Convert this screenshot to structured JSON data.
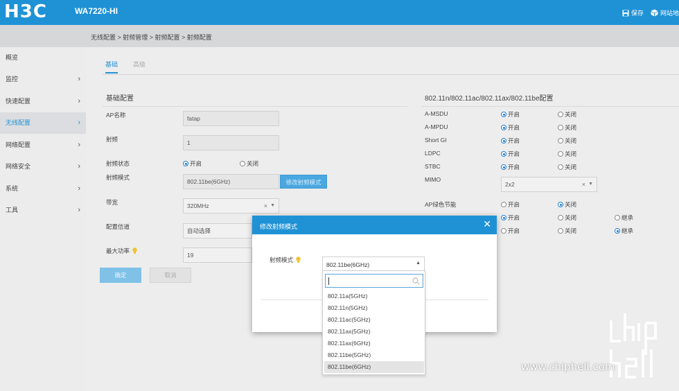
{
  "header": {
    "logo": "H3C",
    "model": "WA7220-HI",
    "actions": [
      {
        "label": "保存",
        "icon": "save-icon"
      },
      {
        "label": "网站地",
        "icon": "cube-icon"
      }
    ]
  },
  "breadcrumb": "无线配置 > 射频管理 > 射频配置 > 射频配置",
  "sidebar": {
    "items": [
      {
        "label": "概览",
        "chevron": false,
        "active": false
      },
      {
        "label": "监控",
        "chevron": true,
        "active": false
      },
      {
        "label": "快速配置",
        "chevron": true,
        "active": false
      },
      {
        "label": "无线配置",
        "chevron": true,
        "active": true
      },
      {
        "label": "网络配置",
        "chevron": true,
        "active": false
      },
      {
        "label": "网络安全",
        "chevron": true,
        "active": false
      },
      {
        "label": "系统",
        "chevron": true,
        "active": false
      },
      {
        "label": "工具",
        "chevron": true,
        "active": false
      }
    ]
  },
  "tabs": [
    {
      "label": "基础",
      "active": true
    },
    {
      "label": "高级",
      "active": false
    }
  ],
  "basic": {
    "title": "基础配置",
    "ap_name": {
      "label": "AP名称",
      "value": "fatap"
    },
    "radio": {
      "label": "射频",
      "value": "1"
    },
    "radio_state": {
      "label": "射频状态",
      "on": "开启",
      "off": "关闭",
      "value": "on"
    },
    "radio_mode": {
      "label": "射频模式",
      "value": "802.11be(6GHz)",
      "button": "修改射频模式"
    },
    "bandwidth": {
      "label": "带宽",
      "value": "320MHz",
      "clear": "×",
      "arrow": "▼"
    },
    "channel": {
      "label": "配置信道",
      "value": "自动选择"
    },
    "max_power": {
      "label": "最大功率",
      "value": "19"
    },
    "confirm": "确定",
    "cancel": "取消"
  },
  "advanced": {
    "title": "802.11n/802.11ac/802.11ax/802.11be配置",
    "rows": [
      {
        "label": "A-MSDU",
        "on": "开启",
        "off": "关闭",
        "value": "on"
      },
      {
        "label": "A-MPDU",
        "on": "开启",
        "off": "关闭",
        "value": "on"
      },
      {
        "label": "Short GI",
        "on": "开启",
        "off": "关闭",
        "value": "on"
      },
      {
        "label": "LDPC",
        "on": "开启",
        "off": "关闭",
        "value": "on"
      },
      {
        "label": "STBC",
        "on": "开启",
        "off": "关闭",
        "value": "on"
      }
    ],
    "mimo": {
      "label": "MIMO",
      "value": "2x2",
      "clear": "×",
      "arrow": "▼"
    },
    "ap_green": {
      "label": "AP绿色节能",
      "on": "开启",
      "off": "关闭",
      "value": "off"
    },
    "row_hidden1": {
      "on": "开启",
      "off": "关闭",
      "inherit": "继承",
      "value": "on"
    },
    "row_hidden2": {
      "on": "开启",
      "off": "关闭",
      "inherit": "继承",
      "value": "inherit"
    }
  },
  "modal": {
    "title": "修改射频模式",
    "close": "✕",
    "label": "射频模式",
    "selected": "802.11be(6GHz)",
    "search_value": "",
    "options": [
      "802.11a(5GHz)",
      "802.11n(5GHz)",
      "802.11ac(5GHz)",
      "802.11ax(5GHz)",
      "802.11ax(6GHz)",
      "802.11be(5GHz)",
      "802.11be(6GHz)"
    ]
  },
  "watermark": {
    "url": "www.chiphell.com",
    "logo_text": "chip hell"
  },
  "colors": {
    "brand": "#1f92d6",
    "bulb": "#f2c230"
  }
}
